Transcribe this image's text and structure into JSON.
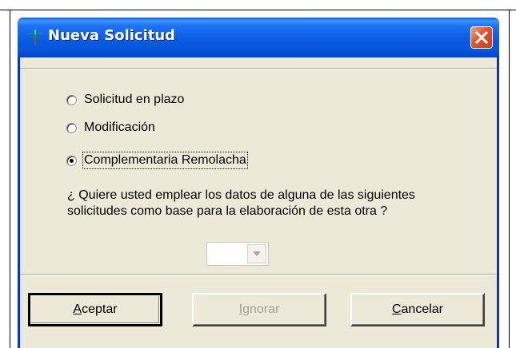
{
  "window": {
    "title": "Nueva Solicitud",
    "title_icon": "palm-tree-icon",
    "close_icon": "close-icon"
  },
  "options": [
    {
      "label": "Solicitud en plazo",
      "selected": false
    },
    {
      "label": "Modificación",
      "selected": false
    },
    {
      "label": "Complementaria Remolacha",
      "selected": true
    }
  ],
  "question": "¿ Quiere usted emplear los  datos de  alguna de  las siguientes solicitudes como base para la elaboración de esta otra ?",
  "combo": {
    "value": "",
    "enabled": false
  },
  "buttons": {
    "accept": {
      "mnemonic": "A",
      "rest": "ceptar",
      "enabled": true,
      "default": true
    },
    "ignore": {
      "mnemonic": "I",
      "rest": "gnorar",
      "enabled": false
    },
    "cancel": {
      "mnemonic": "C",
      "rest": "ancelar",
      "enabled": true
    }
  },
  "colors": {
    "titlebar": "#0a5ce3",
    "dialog_bg": "#ece9d8",
    "close": "#e0512b"
  }
}
